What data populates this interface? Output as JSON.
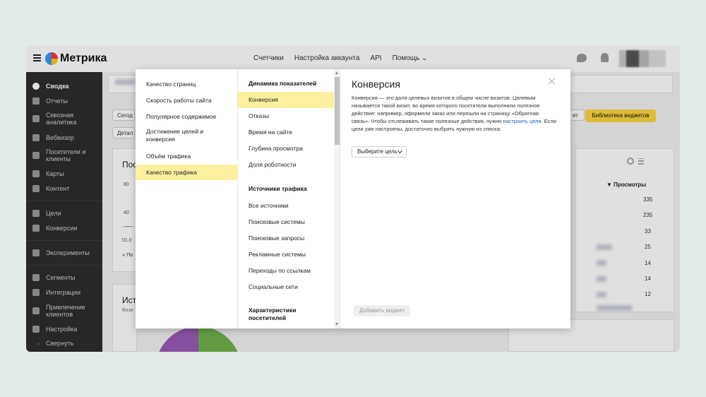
{
  "header": {
    "logo": "Метрика",
    "nav": [
      "Счетчики",
      "Настройка аккаунта",
      "API",
      "Помощь"
    ]
  },
  "sidebar": {
    "items": [
      "Сводка",
      "Отчеты",
      "Сквозная аналитика",
      "Вебвизор",
      "Посетители и клиенты",
      "Карты",
      "Контент",
      "Цели",
      "Конверсии",
      "Эксперименты",
      "Сегменты",
      "Интеграции",
      "Привлечение клиентов",
      "Настройка",
      "Свернуть"
    ]
  },
  "background": {
    "today_btn": "Сегод",
    "detail_btn": "Детал",
    "library_btn": "Библиотека виджетов",
    "right_btn": "ет",
    "panel_title_left": "Пос",
    "panel_title_left2": "Ист",
    "axis_80": "80",
    "axis_40": "40",
    "date_label": "01.0",
    "legend_prefix": "По",
    "visits_label": "Визи",
    "views_header": "▼ Просмотры",
    "views": [
      "335",
      "235",
      "33",
      "25",
      "14",
      "14",
      "12"
    ]
  },
  "modal": {
    "col1": [
      "Качество страниц",
      "Скорость работы сайта",
      "Популярное содержимое",
      "Достижение целей и конверсия",
      "Объём трафика",
      "Качество трафика"
    ],
    "col2_section1": "Динамика показателей",
    "col2_items1": [
      "Конверсия",
      "Отказы",
      "Время на сайте",
      "Глубина просмотра",
      "Доля роботности"
    ],
    "col2_section2": "Источники трафика",
    "col2_items2": [
      "Все источники",
      "Поисковые системы",
      "Поисковые запросы",
      "Рекламные системы",
      "Переходы по ссылкам",
      "Социальные сети"
    ],
    "col2_section3": "Характеристики посетителей",
    "title": "Конверсия",
    "desc_part1": "Конверсия — это доля целевых визитов в общем числе визитов. Целевым называется такой визит, во время которого посетители выполнили полезное действие: например, оформили заказ или перешли на страницу «Обратная связь». Чтобы отслеживать такие полезные действия, нужно ",
    "desc_link": "настроить цели",
    "desc_part2": ". Если цели уже настроены, достаточно выбрать нужную из списка:",
    "goal_select": "Выберите цель",
    "add_widget": "Добавить виджет"
  }
}
